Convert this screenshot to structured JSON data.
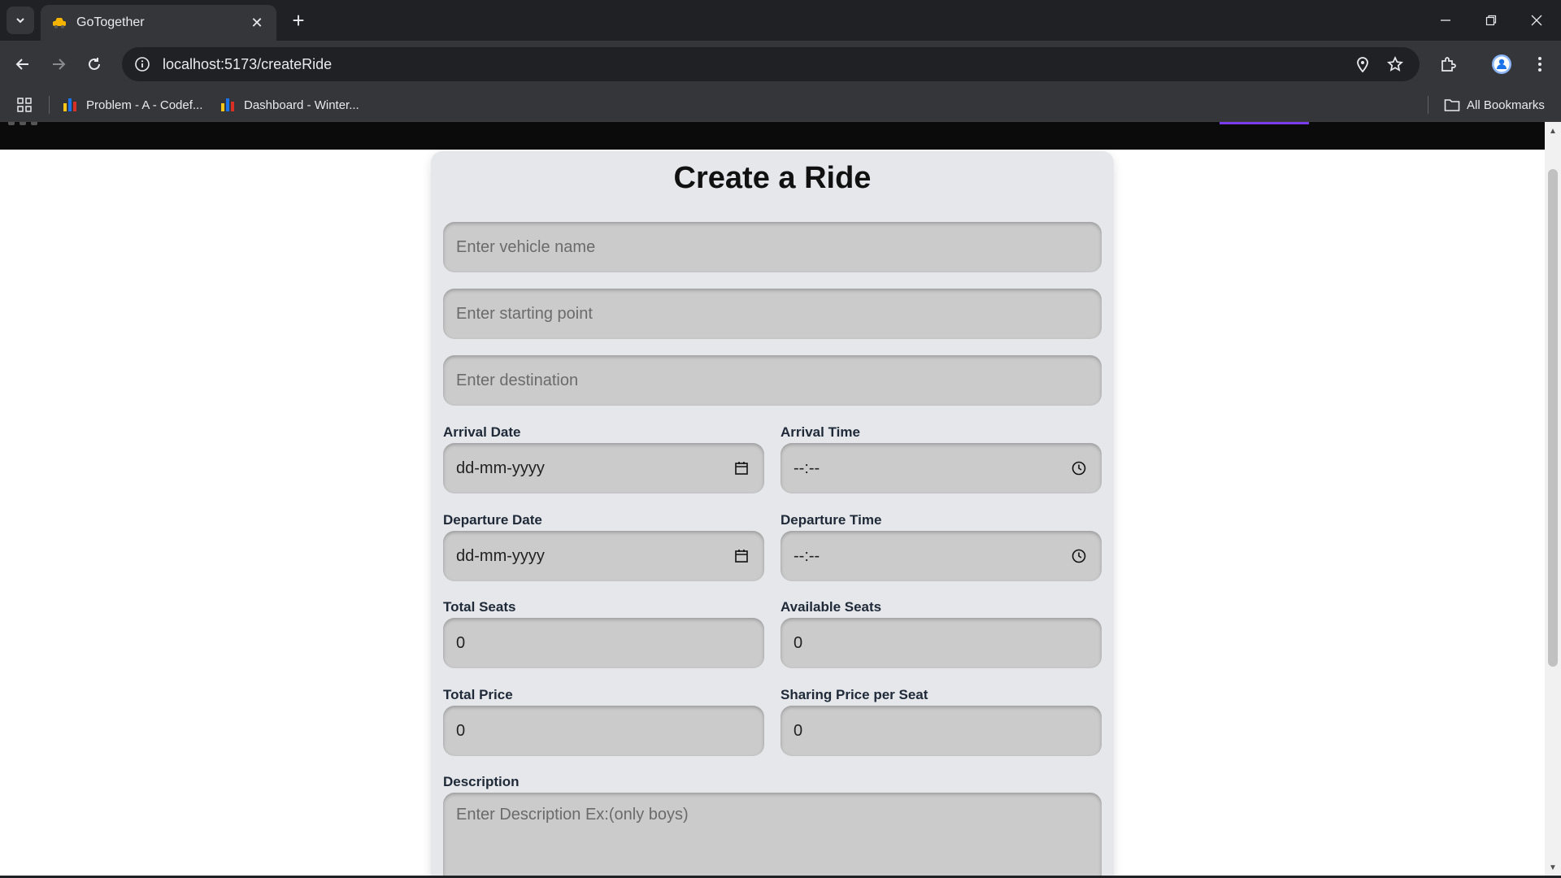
{
  "browser": {
    "tab_title": "GoTogether",
    "url": "localhost:5173/createRide",
    "bookmarks": [
      {
        "label": "Problem - A - Codef..."
      },
      {
        "label": "Dashboard - Winter..."
      }
    ],
    "all_bookmarks_label": "All Bookmarks"
  },
  "form": {
    "title": "Create a Ride",
    "vehicle_placeholder": "Enter vehicle name",
    "start_placeholder": "Enter starting point",
    "destination_placeholder": "Enter destination",
    "arrival_date_label": "Arrival Date",
    "arrival_date_value": "dd-mm-yyyy",
    "arrival_time_label": "Arrival Time",
    "arrival_time_value": "--:--",
    "departure_date_label": "Departure Date",
    "departure_date_value": "dd-mm-yyyy",
    "departure_time_label": "Departure Time",
    "departure_time_value": "--:--",
    "total_seats_label": "Total Seats",
    "total_seats_value": "0",
    "available_seats_label": "Available Seats",
    "available_seats_value": "0",
    "total_price_label": "Total Price",
    "total_price_value": "0",
    "sharing_price_label": "Sharing Price per Seat",
    "sharing_price_value": "0",
    "description_label": "Description",
    "description_placeholder": "Enter Description Ex:(only boys)"
  },
  "colors": {
    "accent": "#7c3aed",
    "card_bg": "#e5e7eb",
    "input_bg": "#cbcbcb"
  }
}
